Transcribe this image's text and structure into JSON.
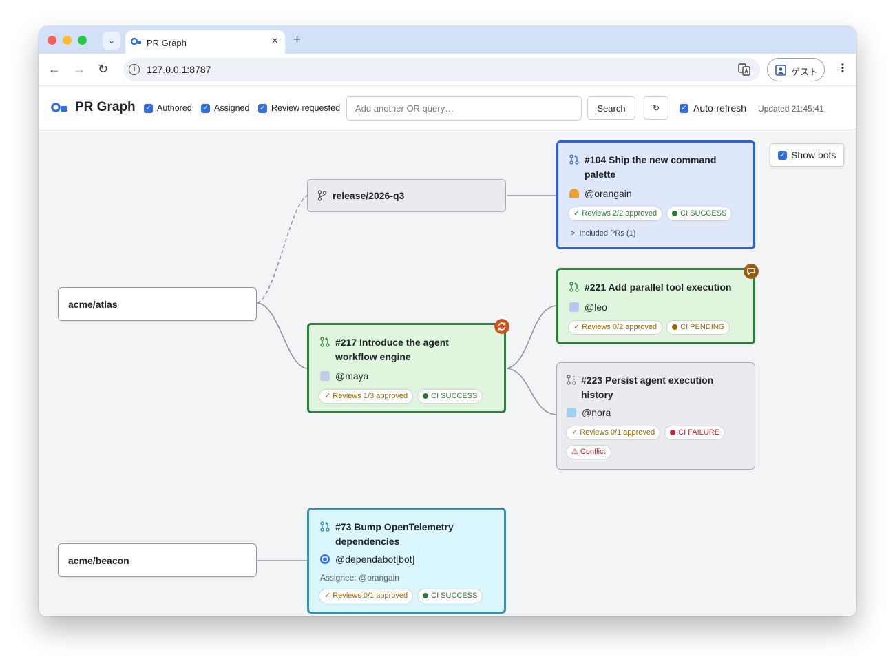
{
  "browser": {
    "tab_title": "PR Graph",
    "url": "127.0.0.1:8787",
    "profile_label": "ゲスト",
    "nav": {
      "back": "←",
      "forward": "→",
      "reload": "↻",
      "menu": "⋮"
    },
    "tab_close": "×",
    "tab_new": "+",
    "tab_dropdown": "⌄",
    "info": "i"
  },
  "header": {
    "title": "PR Graph",
    "filters": [
      {
        "label": "Authored",
        "checked": true
      },
      {
        "label": "Assigned",
        "checked": true
      },
      {
        "label": "Review requested",
        "checked": true
      }
    ],
    "query_placeholder": "Add another OR query…",
    "search_label": "Search",
    "refresh_label": "↻",
    "auto_refresh_label": "Auto-refresh",
    "updated": "Updated 21:45:41"
  },
  "check_mark": "✓",
  "show_bots_label": "Show bots",
  "repos": [
    "acme/atlas",
    "acme/beacon"
  ],
  "branch": {
    "name": "release/2026-q3"
  },
  "prs": [
    {
      "title_line1": "#104 Ship the new command",
      "title_line2": "palette",
      "author": "@orangain",
      "reviews": "✓ Reviews 2/2 approved",
      "ci": "CI SUCCESS",
      "included": "Included PRs (1)",
      "included_chevron": ">"
    },
    {
      "title_line1": "#221 Add parallel tool execution",
      "title_line2": "",
      "author": "@leo",
      "reviews": "✓ Reviews 0/2 approved",
      "ci": "CI PENDING"
    },
    {
      "title_line1": "#217 Introduce the agent",
      "title_line2": "workflow engine",
      "author": "@maya",
      "reviews": "✓ Reviews 1/3 approved",
      "ci": "CI SUCCESS"
    },
    {
      "title_line1": "#223 Persist agent execution",
      "title_line2": "history",
      "author": "@nora",
      "reviews": "✓ Reviews 0/1 approved",
      "ci": "CI FAILURE",
      "conflict": "⚠ Conflict"
    },
    {
      "title_line1": "#73 Bump OpenTelemetry",
      "title_line2": "dependencies",
      "author": "@dependabot[bot]",
      "assignee": "Assignee: @orangain",
      "reviews": "✓ Reviews 0/1 approved",
      "ci": "CI SUCCESS"
    }
  ],
  "colors": {
    "accent_blue": "#2f6de1",
    "approved_green": "#2c7a3a",
    "pending_brown": "#9a6700",
    "failure_red": "#cf222e",
    "bot_cyan_bg": "#d8f6fb"
  }
}
